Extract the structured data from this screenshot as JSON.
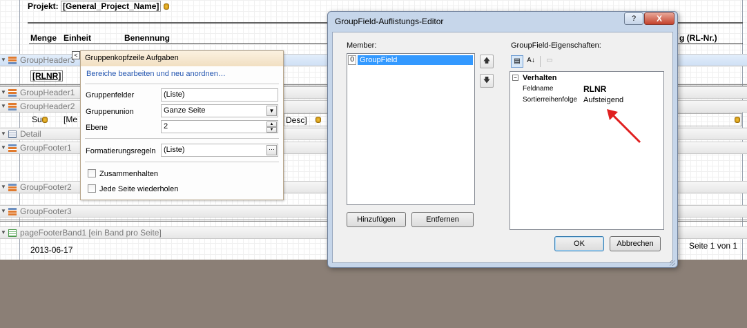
{
  "report": {
    "projekt_label": "Projekt:",
    "projekt_value": "[General_Project_Name]",
    "columns": [
      "Menge",
      "Einheit",
      "Benennung"
    ],
    "right_header": "g (RL-Nr.)",
    "rlnr_field": "[RLNR]",
    "row_sum": "Su",
    "row_me": "[Me",
    "row_desc": "Desc]",
    "footer_date": "2013-06-17",
    "footer_page": "Seite 1 von 1",
    "bands": {
      "gh3": "GroupHeader3",
      "gh1": "GroupHeader1",
      "gh2": "GroupHeader2",
      "detail": "Detail",
      "gf1": "GroupFooter1",
      "gf2": "GroupFooter2",
      "gf3": "GroupFooter3",
      "pagefooter": "pageFooterBand1 [ein Band pro Seite]"
    }
  },
  "smart_panel": {
    "title": "Gruppenkopfzeile Aufgaben",
    "link": "Bereiche bearbeiten und neu anordnen…",
    "rows": {
      "gruppenfelder_label": "Gruppenfelder",
      "gruppenfelder_value": "(Liste)",
      "gruppenunion_label": "Gruppenunion",
      "gruppenunion_value": "Ganze Seite",
      "ebene_label": "Ebene",
      "ebene_value": "2",
      "formatierung_label": "Formatierungsregeln",
      "formatierung_value": "(Liste)"
    },
    "checks": {
      "zusammenhalten": "Zusammenhalten",
      "jede_seite": "Jede Seite wiederholen"
    }
  },
  "dialog": {
    "title": "GroupField-Auflistungs-Editor",
    "help": "?",
    "close": "X",
    "member_label": "Member:",
    "member_index": "0",
    "member_item": "GroupField",
    "props_label": "GroupField-Eigenschaften:",
    "category": "Verhalten",
    "prop1_name": "Feldname",
    "prop1_value": "RLNR",
    "prop2_name": "Sortierreihenfolge",
    "prop2_value": "Aufsteigend",
    "add_button": "Hinzufügen",
    "remove_button": "Entfernen",
    "ok_button": "OK",
    "cancel_button": "Abbrechen"
  },
  "colors": {
    "arrow": "#e02020",
    "selection": "#3399ff",
    "dialog_frame": "#c6d6ea",
    "desktop": "#8b7f76"
  }
}
